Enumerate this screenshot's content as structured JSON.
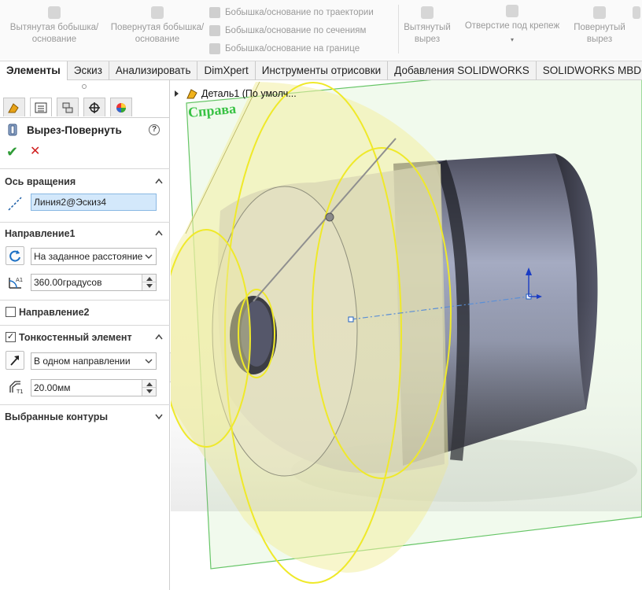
{
  "ribbon": {
    "extruded_boss": "Вытянутая бобышка/основание",
    "revolved_boss": "Повернутая бобышка/основание",
    "swept_boss": "Бобышка/основание по траектории",
    "lofted_boss": "Бобышка/основание по сечениям",
    "boundary_boss": "Бобышка/основание на границе",
    "extruded_cut": "Вытянутый вырез",
    "hole_wizard": "Отверстие под крепеж",
    "revolved_cut": "Повернутый вырез"
  },
  "tabs": [
    "Элементы",
    "Эскиз",
    "Анализировать",
    "DimXpert",
    "Инструменты отрисовки",
    "Добавления SOLIDWORKS",
    "SOLIDWORKS MBD"
  ],
  "panel": {
    "title": "Вырез-Повернуть",
    "axis": {
      "header": "Ось вращения",
      "value": "Линия2@Эскиз4"
    },
    "direction1": {
      "header": "Направление1",
      "type": "На заданное расстояние",
      "angle": "360.00градусов"
    },
    "direction2": {
      "header": "Направление2",
      "checked": false
    },
    "thin": {
      "header": "Тонкостенный элемент",
      "checked": true,
      "type": "В одном направлении",
      "thickness": "20.00мм"
    },
    "contours": {
      "header": "Выбранные контуры"
    }
  },
  "viewport": {
    "tree_label": "Деталь1  (По умолч...",
    "plane_label": "Справа"
  },
  "colors": {
    "ok_green": "#2f9c37",
    "cancel_red": "#d02020",
    "selection_blue": "#d3e8fb",
    "plane_green": "#38c244",
    "preview_yellow": "#f0ee30",
    "body_steel": "#8d93a8"
  }
}
